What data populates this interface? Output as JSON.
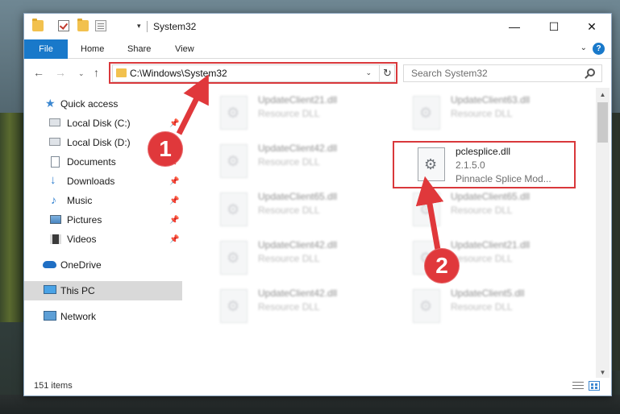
{
  "window": {
    "title": "System32",
    "quick_access_dropdown": "▾",
    "controls": {
      "minimize": "—",
      "maximize": "☐",
      "close": "✕"
    }
  },
  "ribbon": {
    "tabs": [
      {
        "label": "File",
        "active": true
      },
      {
        "label": "Home"
      },
      {
        "label": "Share"
      },
      {
        "label": "View"
      }
    ],
    "expand_glyph": "⌄",
    "help_glyph": "?"
  },
  "navigation": {
    "back": "←",
    "forward": "→",
    "recent": "⌄",
    "up": "↑",
    "address": "C:\\Windows\\System32",
    "address_dropdown": "⌄",
    "refresh": "↻",
    "search_placeholder": "Search System32"
  },
  "sidebar": {
    "items": [
      {
        "label": "Quick access",
        "icon": "star-icon",
        "pinned": false
      },
      {
        "label": "Local Disk (C:)",
        "icon": "drive-icon",
        "pinned": true
      },
      {
        "label": "Local Disk (D:)",
        "icon": "drive-icon",
        "pinned": true
      },
      {
        "label": "Documents",
        "icon": "documents-icon",
        "pinned": true
      },
      {
        "label": "Downloads",
        "icon": "download-icon",
        "pinned": true
      },
      {
        "label": "Music",
        "icon": "music-icon",
        "pinned": true
      },
      {
        "label": "Pictures",
        "icon": "pictures-icon",
        "pinned": true
      },
      {
        "label": "Videos",
        "icon": "videos-icon",
        "pinned": true
      },
      {
        "label": "OneDrive",
        "icon": "cloud-icon",
        "pinned": false
      },
      {
        "label": "This PC",
        "icon": "computer-icon",
        "pinned": false,
        "selected": true
      },
      {
        "label": "Network",
        "icon": "network-icon",
        "pinned": false
      }
    ],
    "pin_glyph": "📌"
  },
  "files": [
    {
      "name": "UpdateClient21.dll",
      "desc": "Resource DLL"
    },
    {
      "name": "UpdateClient63.dll",
      "desc": "Resource DLL"
    },
    {
      "name": "UpdateClient42.dll",
      "desc": "Resource DLL"
    },
    {
      "name": "pclesplice.dll",
      "version": "2.1.5.0",
      "company": "Pinnacle Splice Mod...",
      "highlighted": true
    },
    {
      "name": "UpdateClient65.dll",
      "desc": "Resource DLL"
    },
    {
      "name": "UpdateClient65.dll",
      "desc": "Resource DLL"
    },
    {
      "name": "UpdateClient42.dll",
      "desc": "Resource DLL"
    },
    {
      "name": "UpdateClient21.dll",
      "desc": "Resource DLL"
    },
    {
      "name": "UpdateClient42.dll",
      "desc": "Resource DLL"
    },
    {
      "name": "UpdateClient5.dll",
      "desc": "Resource DLL"
    }
  ],
  "status": {
    "item_count": "151 items"
  },
  "callouts": [
    {
      "number": "1"
    },
    {
      "number": "2"
    }
  ],
  "colors": {
    "accent": "#1979ca",
    "highlight": "#d9383b",
    "selection": "#d9d9d9"
  }
}
